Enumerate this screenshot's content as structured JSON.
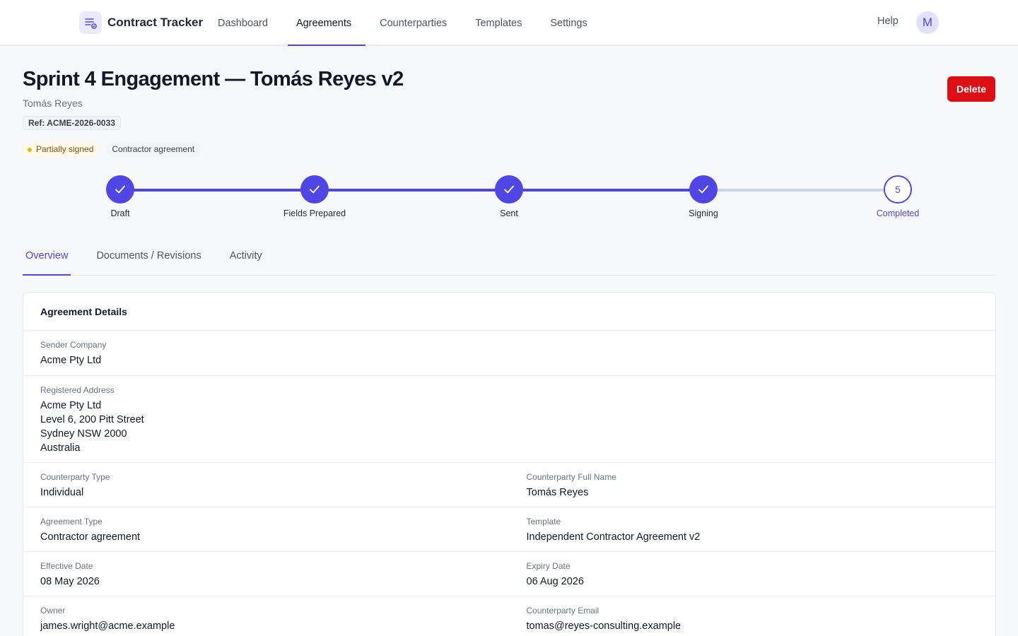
{
  "app": {
    "name": "Contract Tracker",
    "brand_icon": "document-list-icon",
    "accent_color": "#5046e5",
    "danger_color": "#dc0f14"
  },
  "nav": {
    "items": [
      {
        "label": "Dashboard",
        "active": false
      },
      {
        "label": "Agreements",
        "active": true
      },
      {
        "label": "Counterparties",
        "active": false
      },
      {
        "label": "Templates",
        "active": false
      },
      {
        "label": "Settings",
        "active": false
      }
    ],
    "help_label": "Help",
    "avatar_initial": "M"
  },
  "agreement": {
    "title": "Sprint 4 Engagement — Tomás Reyes v2",
    "subtitle": "Tomás Reyes",
    "ref": "Ref: ACME-2026-0033",
    "status_badge": "Partially signed",
    "type_badge": "Contractor agreement",
    "delete_label": "Delete"
  },
  "stepper": {
    "steps": [
      {
        "label": "Draft",
        "state": "done"
      },
      {
        "label": "Fields Prepared",
        "state": "done"
      },
      {
        "label": "Sent",
        "state": "done"
      },
      {
        "label": "Signing",
        "state": "done"
      },
      {
        "label": "Completed",
        "state": "current",
        "number": "5"
      }
    ]
  },
  "tabs": [
    {
      "label": "Overview",
      "active": true
    },
    {
      "label": "Documents / Revisions",
      "active": false
    },
    {
      "label": "Activity",
      "active": false
    }
  ],
  "details": {
    "header": "Agreement Details",
    "sender_company": {
      "label": "Sender Company",
      "value": "Acme Pty Ltd"
    },
    "registered_address": {
      "label": "Registered Address",
      "lines": [
        "Acme Pty Ltd",
        "Level 6, 200 Pitt Street",
        "Sydney NSW 2000",
        "Australia"
      ]
    },
    "counterparty_type": {
      "label": "Counterparty Type",
      "value": "Individual"
    },
    "counterparty_full_name": {
      "label": "Counterparty Full Name",
      "value": "Tomás Reyes"
    },
    "agreement_type": {
      "label": "Agreement Type",
      "value": "Contractor agreement"
    },
    "template": {
      "label": "Template",
      "value": "Independent Contractor Agreement v2"
    },
    "effective_date": {
      "label": "Effective Date",
      "value": "08 May 2026"
    },
    "expiry_date": {
      "label": "Expiry Date",
      "value": "06 Aug 2026"
    },
    "owner": {
      "label": "Owner",
      "value": "james.wright@acme.example"
    },
    "counterparty_email": {
      "label": "Counterparty Email",
      "value": "tomas@reyes-consulting.example"
    }
  }
}
